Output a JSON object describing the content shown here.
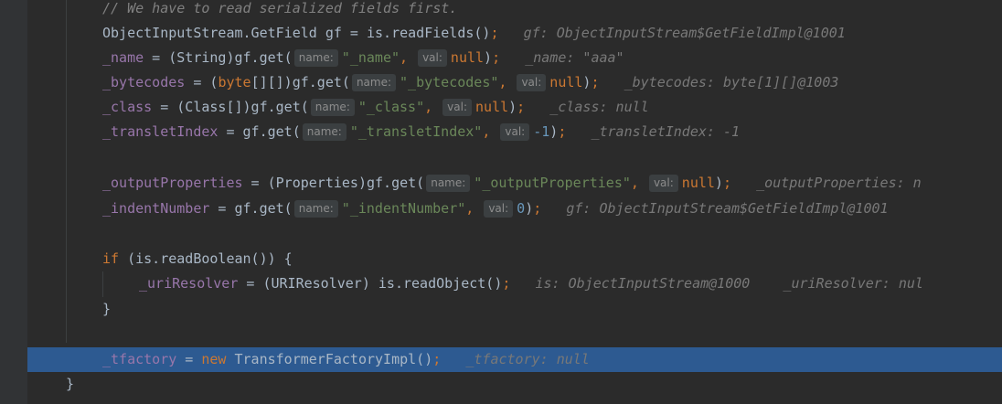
{
  "editor": {
    "comment": "// We have to read serialized fields first.",
    "line_get_fields": {
      "type": "ObjectInputStream.GetField",
      "rest": " gf = is.readFields()",
      "semi": ";",
      "debug": "gf: ObjectInputStream$GetFieldImpl@1001"
    },
    "line_name": {
      "field": "_name",
      "mid": " = (String)gf.get(",
      "hint_name": "name:",
      "str": "\"_name\"",
      "comma": ",",
      "hint_val": "val:",
      "val": "null",
      "close": ")",
      "semi": ";",
      "debug": "_name: \"aaa\""
    },
    "line_bytecodes": {
      "field": "_bytecodes",
      "mid1": " = (",
      "kw": "byte",
      "mid2": "[][])gf.get(",
      "hint_name": "name:",
      "str": "\"_bytecodes\"",
      "comma": ",",
      "hint_val": "val:",
      "val": "null",
      "close": ")",
      "semi": ";",
      "debug": "_bytecodes: byte[1][]@1003"
    },
    "line_class": {
      "field": "_class",
      "mid": " = (Class[])gf.get(",
      "hint_name": "name:",
      "str": "\"_class\"",
      "comma": ",",
      "hint_val": "val:",
      "val": "null",
      "close": ")",
      "semi": ";",
      "debug": "_class: null"
    },
    "line_translet": {
      "field": "_transletIndex",
      "mid": " = gf.get(",
      "hint_name": "name:",
      "str": "\"_transletIndex\"",
      "comma": ",",
      "hint_val": "val:",
      "val": "-1",
      "close": ")",
      "semi": ";",
      "debug": "_transletIndex: -1"
    },
    "line_output": {
      "field": "_outputProperties",
      "mid": " = (Properties)gf.get(",
      "hint_name": "name:",
      "str": "\"_outputProperties\"",
      "comma": ",",
      "hint_val": "val:",
      "val": "null",
      "close": ")",
      "semi": ";",
      "debug": "_outputProperties: n"
    },
    "line_indent": {
      "field": "_indentNumber",
      "mid": " = gf.get(",
      "hint_name": "name:",
      "str": "\"_indentNumber\"",
      "comma": ",",
      "hint_val": "val:",
      "val": "0",
      "close": ")",
      "semi": ";",
      "debug": "gf: ObjectInputStream$GetFieldImpl@1001"
    },
    "line_if": {
      "kw": "if",
      "rest": " (is.readBoolean()) {"
    },
    "line_uri": {
      "field": "_uriResolver",
      "mid": " = (URIResolver) is.readObject()",
      "semi": ";",
      "debug1": "is: ObjectInputStream@1000",
      "debug2": "_uriResolver: nul"
    },
    "line_close_if": "}",
    "line_tfactory": {
      "field": "_tfactory",
      "mid1": " = ",
      "kw": "new",
      "mid2": " TransformerFactoryImpl()",
      "semi": ";",
      "debug": "_tfactory: null"
    },
    "line_close_method": "}",
    "colors": {
      "background": "#2b2b2b",
      "gutter": "#313335",
      "current_line": "#2d5a91",
      "keyword": "#cc7832",
      "field": "#9876aa",
      "string": "#6a8759",
      "number": "#6897bb",
      "comment": "#808080",
      "default_text": "#a9b7c6"
    }
  }
}
